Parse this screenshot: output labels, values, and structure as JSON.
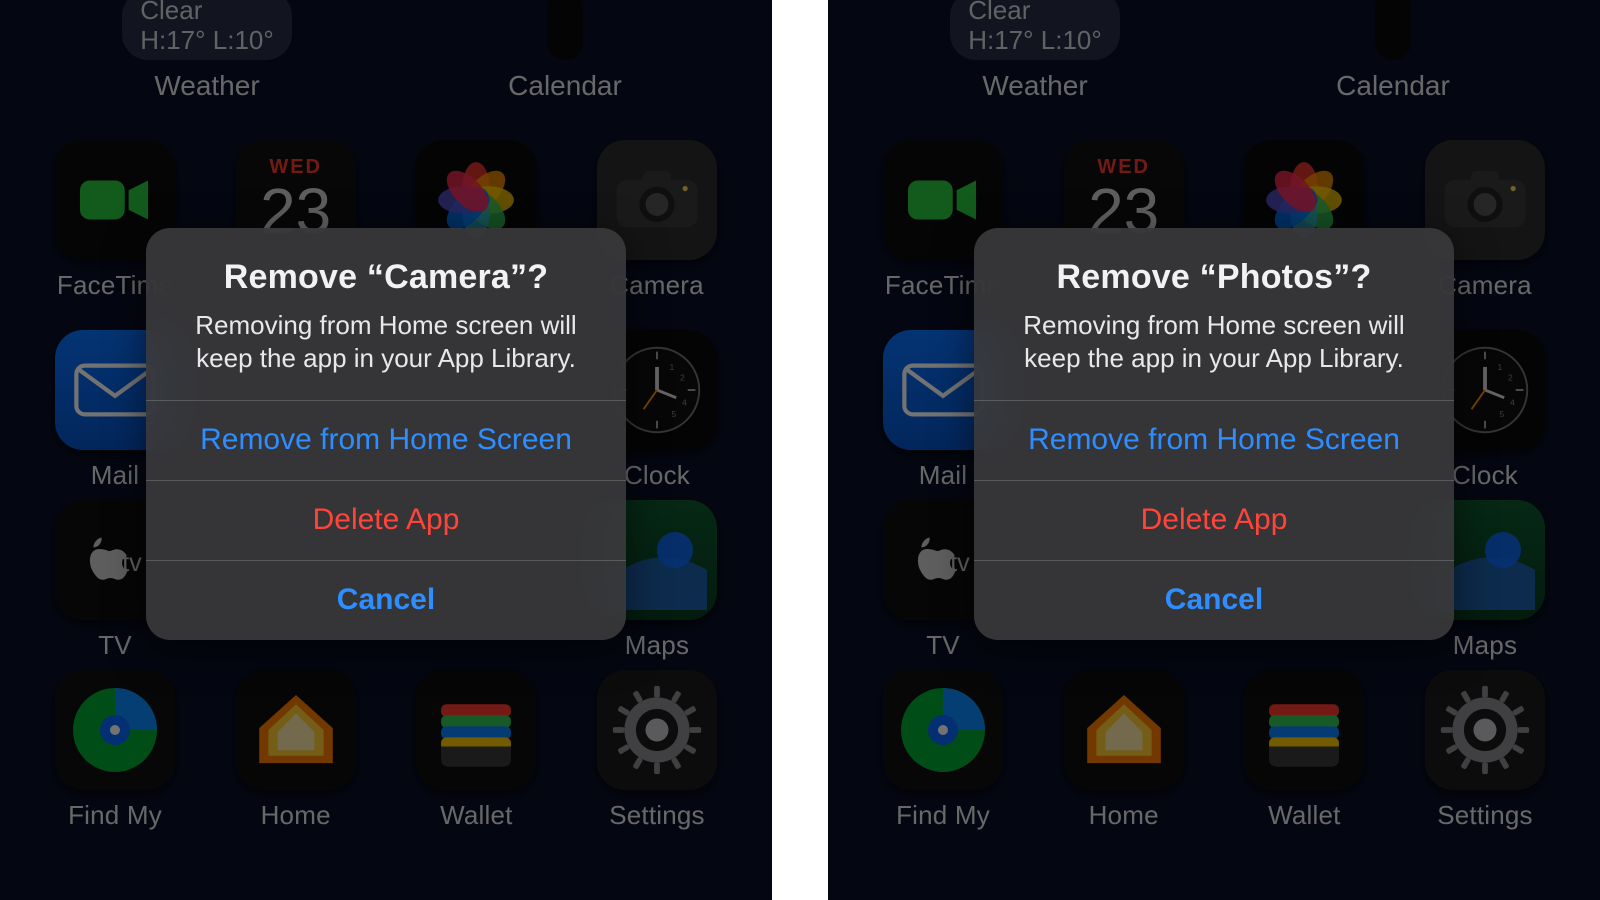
{
  "screens": [
    {
      "weather_widget": {
        "line1": "Clear",
        "line2": "H:17° L:10°",
        "label": "Weather"
      },
      "calendar_widget": {
        "label": "Calendar"
      },
      "row1": {
        "facetime": {
          "label": "FaceTime"
        },
        "calendar": {
          "dow": "WED",
          "day": "23"
        },
        "photos": {},
        "camera": {
          "label": "Camera"
        }
      },
      "row2": {
        "mail": {
          "label": "Mail"
        },
        "clock": {
          "label": "Clock"
        }
      },
      "row3": {
        "tv": {
          "label": "TV"
        },
        "maps": {
          "label": "Maps"
        }
      },
      "row4": {
        "findmy": {
          "label": "Find My"
        },
        "home": {
          "label": "Home"
        },
        "wallet": {
          "label": "Wallet"
        },
        "settings": {
          "label": "Settings"
        }
      },
      "alert": {
        "title": "Remove “Camera”?",
        "message": "Removing from Home screen will keep the app in your App Library.",
        "remove": "Remove from Home Screen",
        "delete": "Delete App",
        "cancel": "Cancel"
      }
    },
    {
      "weather_widget": {
        "line1": "Clear",
        "line2": "H:17° L:10°",
        "label": "Weather"
      },
      "calendar_widget": {
        "label": "Calendar"
      },
      "row1": {
        "facetime": {
          "label": "FaceTime"
        },
        "calendar": {
          "dow": "WED",
          "day": "23"
        },
        "photos": {},
        "camera": {
          "label": "Camera"
        }
      },
      "row2": {
        "mail": {
          "label": "Mail"
        },
        "clock": {
          "label": "Clock"
        }
      },
      "row3": {
        "tv": {
          "label": "TV"
        },
        "maps": {
          "label": "Maps"
        }
      },
      "row4": {
        "findmy": {
          "label": "Find My"
        },
        "home": {
          "label": "Home"
        },
        "wallet": {
          "label": "Wallet"
        },
        "settings": {
          "label": "Settings"
        }
      },
      "alert": {
        "title": "Remove “Photos”?",
        "message": "Removing from Home screen will keep the app in your App Library.",
        "remove": "Remove from Home Screen",
        "delete": "Delete App",
        "cancel": "Cancel"
      }
    }
  ]
}
